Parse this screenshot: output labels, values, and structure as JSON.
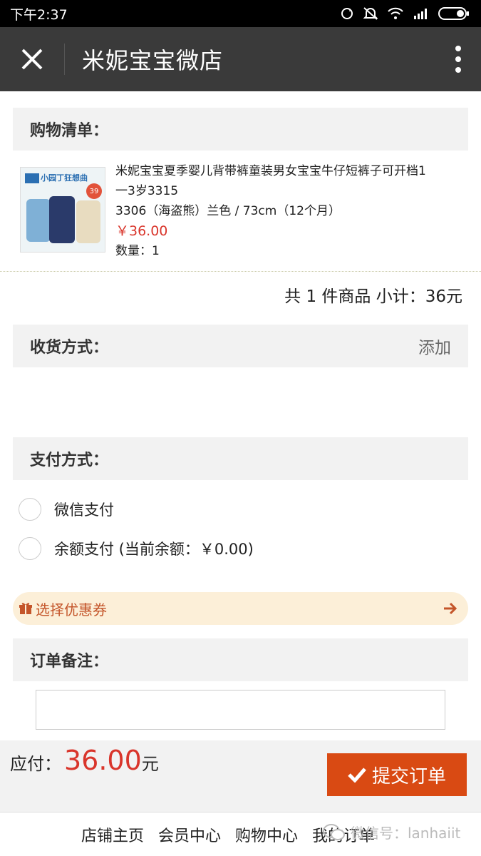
{
  "status_bar": {
    "time": "下午2:37"
  },
  "app_bar": {
    "title": "米妮宝宝微店"
  },
  "cart": {
    "header": "购物清单：",
    "item": {
      "title_line1": "米妮宝宝夏季婴儿背带裤童装男女宝宝牛仔短裤子可开档1",
      "title_line2": "一3岁3315",
      "spec": "3306（海盗熊）兰色 / 73cm（12个月）",
      "price": "￥36.00",
      "quantity": "数量：1",
      "image_text": "小园丁狂想曲",
      "image_badge": "39"
    },
    "subtotal": "共 1 件商品 小计：36元"
  },
  "shipping": {
    "header": "收货方式：",
    "action": "添加"
  },
  "payment": {
    "header": "支付方式：",
    "options": [
      "微信支付",
      "余额支付 (当前余额：￥0.00)"
    ]
  },
  "coupon": {
    "label": "选择优惠券"
  },
  "remark": {
    "header": "订单备注：",
    "value": "",
    "placeholder": ""
  },
  "checkout": {
    "label": "应付：",
    "amount": "36.00",
    "unit": "元",
    "submit": "提交订单"
  },
  "footer": {
    "links": [
      "店铺主页",
      "会员中心",
      "购物中心",
      "我的订单"
    ]
  },
  "watermark": {
    "text": "微信号：lanhaiit"
  },
  "colors": {
    "accent": "#d94a13",
    "price": "#d9352b",
    "appbar": "#3a3a3a",
    "coupon_bg": "#fcefd8"
  }
}
